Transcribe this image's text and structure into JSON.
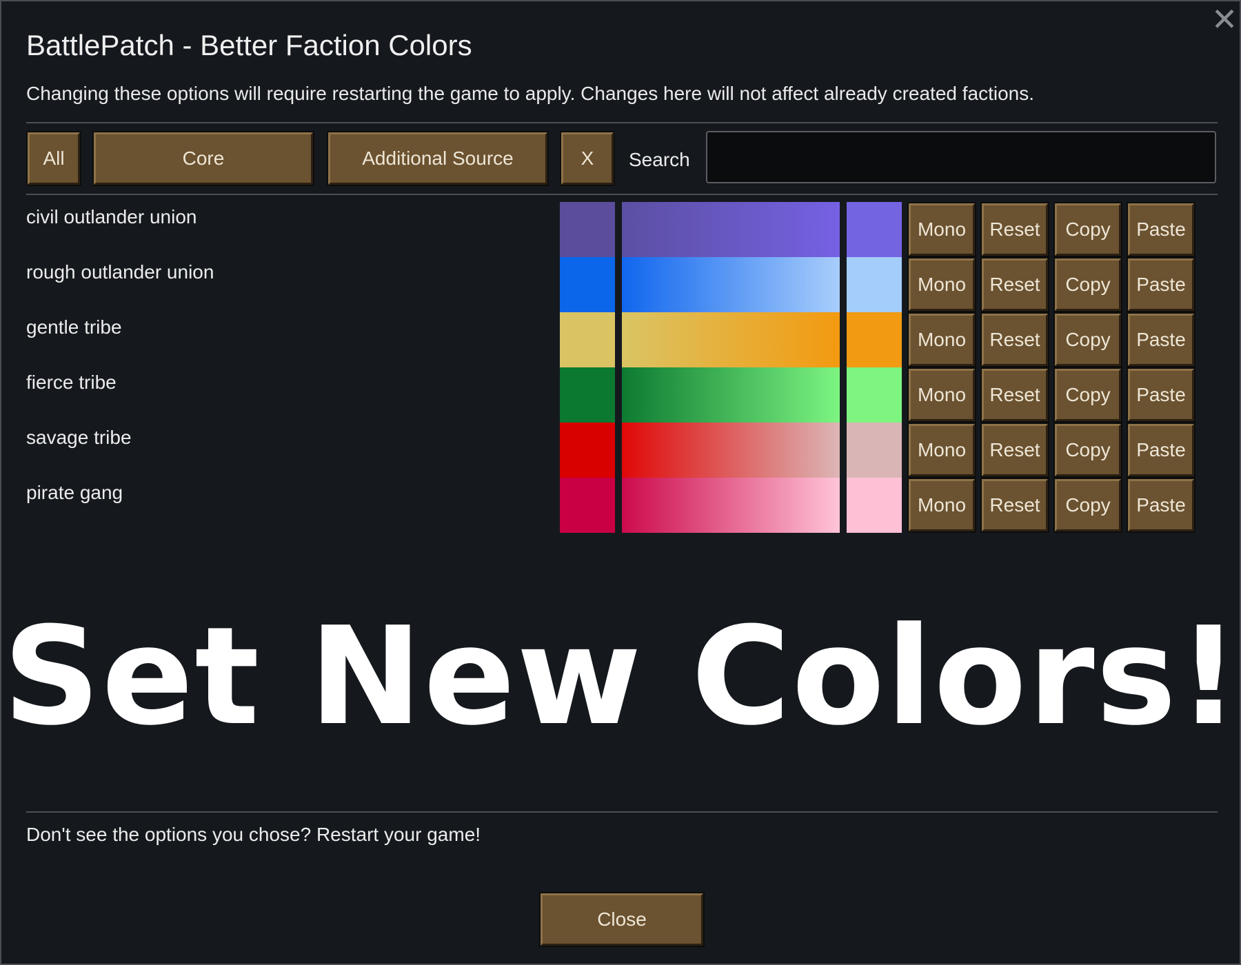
{
  "window": {
    "title": "BattlePatch - Better Faction Colors",
    "subtitle": "Changing these options will require restarting the game to apply. Changes here will not affect already created factions.",
    "close_icon": "close-icon"
  },
  "filters": {
    "tabs": [
      "All",
      "Core",
      "Additional Source",
      "X"
    ],
    "search_label": "Search",
    "search_value": ""
  },
  "row_buttons": {
    "mono": "Mono",
    "reset": "Reset",
    "copy": "Copy",
    "paste": "Paste"
  },
  "factions": [
    {
      "name": "civil outlander union",
      "color_a": "#5b4d9b",
      "gradient_start": "#5b4fa2",
      "gradient_end": "#7561e3",
      "color_b": "#7364e2"
    },
    {
      "name": "rough outlander union",
      "color_a": "#0b66ea",
      "gradient_start": "#1166ee",
      "gradient_end": "#a8cdfb",
      "color_b": "#a4cdfb"
    },
    {
      "name": "gentle tribe",
      "color_a": "#dac363",
      "gradient_start": "#dac463",
      "gradient_end": "#f39a10",
      "color_b": "#f19a12"
    },
    {
      "name": "fierce tribe",
      "color_a": "#0b792f",
      "gradient_start": "#0d7a31",
      "gradient_end": "#7df582",
      "color_b": "#7ef581"
    },
    {
      "name": "savage tribe",
      "color_a": "#d90000",
      "gradient_start": "#e00808",
      "gradient_end": "#dcb6b6",
      "color_b": "#dab5b5"
    },
    {
      "name": "pirate gang",
      "color_a": "#c90043",
      "gradient_start": "#cc0a4c",
      "gradient_end": "#ffc4d8",
      "color_b": "#fec0d5"
    }
  ],
  "banner": "Set New Colors!",
  "footer": {
    "message": "Don't see the options you chose? Restart your game!",
    "close_label": "Close"
  }
}
